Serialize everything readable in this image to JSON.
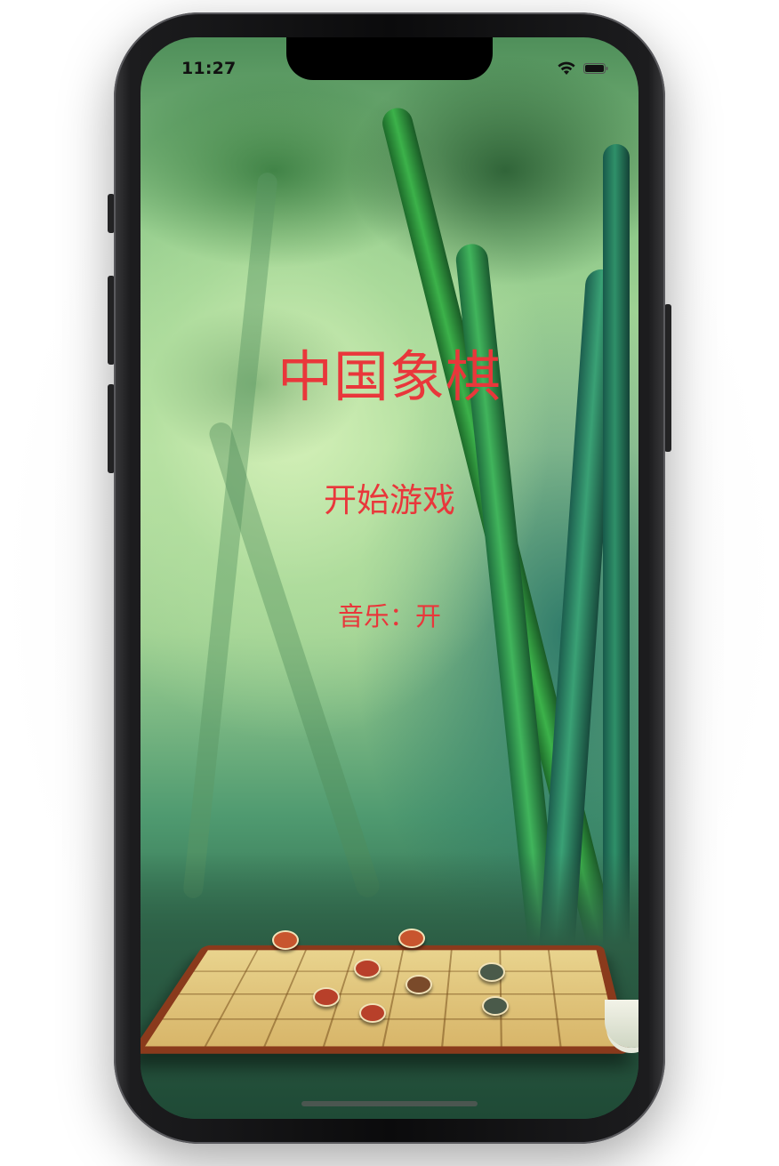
{
  "status_bar": {
    "time": "11:27",
    "icons": [
      "wifi-icon",
      "battery-icon"
    ]
  },
  "game": {
    "title": "中国象棋",
    "start_label": "开始游戏",
    "music_label": "音乐：开"
  },
  "colors": {
    "text_accent": "#e9373b",
    "board_wood": "#8a3a1c",
    "board_surface": "#e9d48e"
  }
}
